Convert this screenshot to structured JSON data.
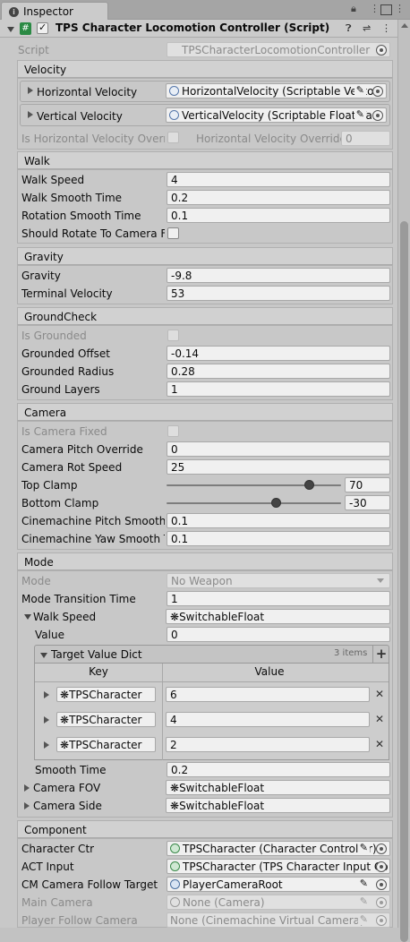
{
  "tab": {
    "title": "Inspector"
  },
  "component": {
    "title": "TPS Character Locomotion Controller (Script)",
    "script_label": "Script",
    "script_value": "TPSCharacterLocomotionController"
  },
  "velocity": {
    "title": "Velocity",
    "horizontal_label": "Horizontal Velocity",
    "horizontal_value": "HorizontalVelocity (Scriptable Vector",
    "vertical_label": "Vertical Velocity",
    "vertical_value": "VerticalVelocity (Scriptable Float Vari",
    "is_h_override_label": "Is Horizontal Velocity Overrid",
    "h_override_label": "Horizontal Velocity Override",
    "h_override_value": "0"
  },
  "walk": {
    "title": "Walk",
    "speed_label": "Walk Speed",
    "speed_value": "4",
    "smooth_label": "Walk Smooth Time",
    "smooth_value": "0.2",
    "rot_label": "Rotation Smooth Time",
    "rot_value": "0.1",
    "rotate_label": "Should Rotate To Camera Fo"
  },
  "gravity": {
    "title": "Gravity",
    "gravity_label": "Gravity",
    "gravity_value": "-9.8",
    "terminal_label": "Terminal Velocity",
    "terminal_value": "53"
  },
  "ground": {
    "title": "GroundCheck",
    "grounded_label": "Is Grounded",
    "offset_label": "Grounded Offset",
    "offset_value": "-0.14",
    "radius_label": "Grounded Radius",
    "radius_value": "0.28",
    "layers_label": "Ground Layers",
    "layers_value": "1"
  },
  "camera": {
    "title": "Camera",
    "fixed_label": "Is Camera Fixed",
    "pitch_label": "Camera Pitch Override",
    "pitch_value": "0",
    "rot_label": "Camera Rot Speed",
    "rot_value": "25",
    "top_label": "Top Clamp",
    "top_value": "70",
    "top_fraction": 0.82,
    "bottom_label": "Bottom Clamp",
    "bottom_value": "-30",
    "bottom_fraction": 0.63,
    "cm_pitch_label": "Cinemachine Pitch Smooth T",
    "cm_pitch_value": "0.1",
    "cm_yaw_label": "Cinemachine Yaw Smooth T",
    "cm_yaw_value": "0.1"
  },
  "mode": {
    "title": "Mode",
    "mode_label": "Mode",
    "mode_value": "No Weapon",
    "trans_label": "Mode Transition Time",
    "trans_value": "1",
    "walk_speed_label": "Walk Speed",
    "walk_speed_value": "SwitchableFloat",
    "value_label": "Value",
    "value_value": "0",
    "dict_label": "Target Value Dict",
    "dict_count": "3 items",
    "dict_key_header": "Key",
    "dict_value_header": "Value",
    "dict_rows": [
      {
        "key": "TPSCharacter",
        "value": "6"
      },
      {
        "key": "TPSCharacter",
        "value": "4"
      },
      {
        "key": "TPSCharacter",
        "value": "2"
      }
    ],
    "smooth_label": "Smooth Time",
    "smooth_value": "0.2",
    "fov_label": "Camera FOV",
    "fov_value": "SwitchableFloat",
    "side_label": "Camera Side",
    "side_value": "SwitchableFloat"
  },
  "comp": {
    "title": "Component",
    "ctr_label": "Character Ctr",
    "ctr_value": "TPSCharacter (Character Controller)",
    "act_label": "ACT Input",
    "act_value": "TPSCharacter (TPS Character Input Co",
    "cm_label": "CM Camera Follow Target",
    "cm_value": "PlayerCameraRoot",
    "main_label": "Main Camera",
    "main_value": "None (Camera)",
    "follow_label": "Player Follow Camera",
    "follow_value": "None (Cinemachine Virtual Camera)"
  }
}
